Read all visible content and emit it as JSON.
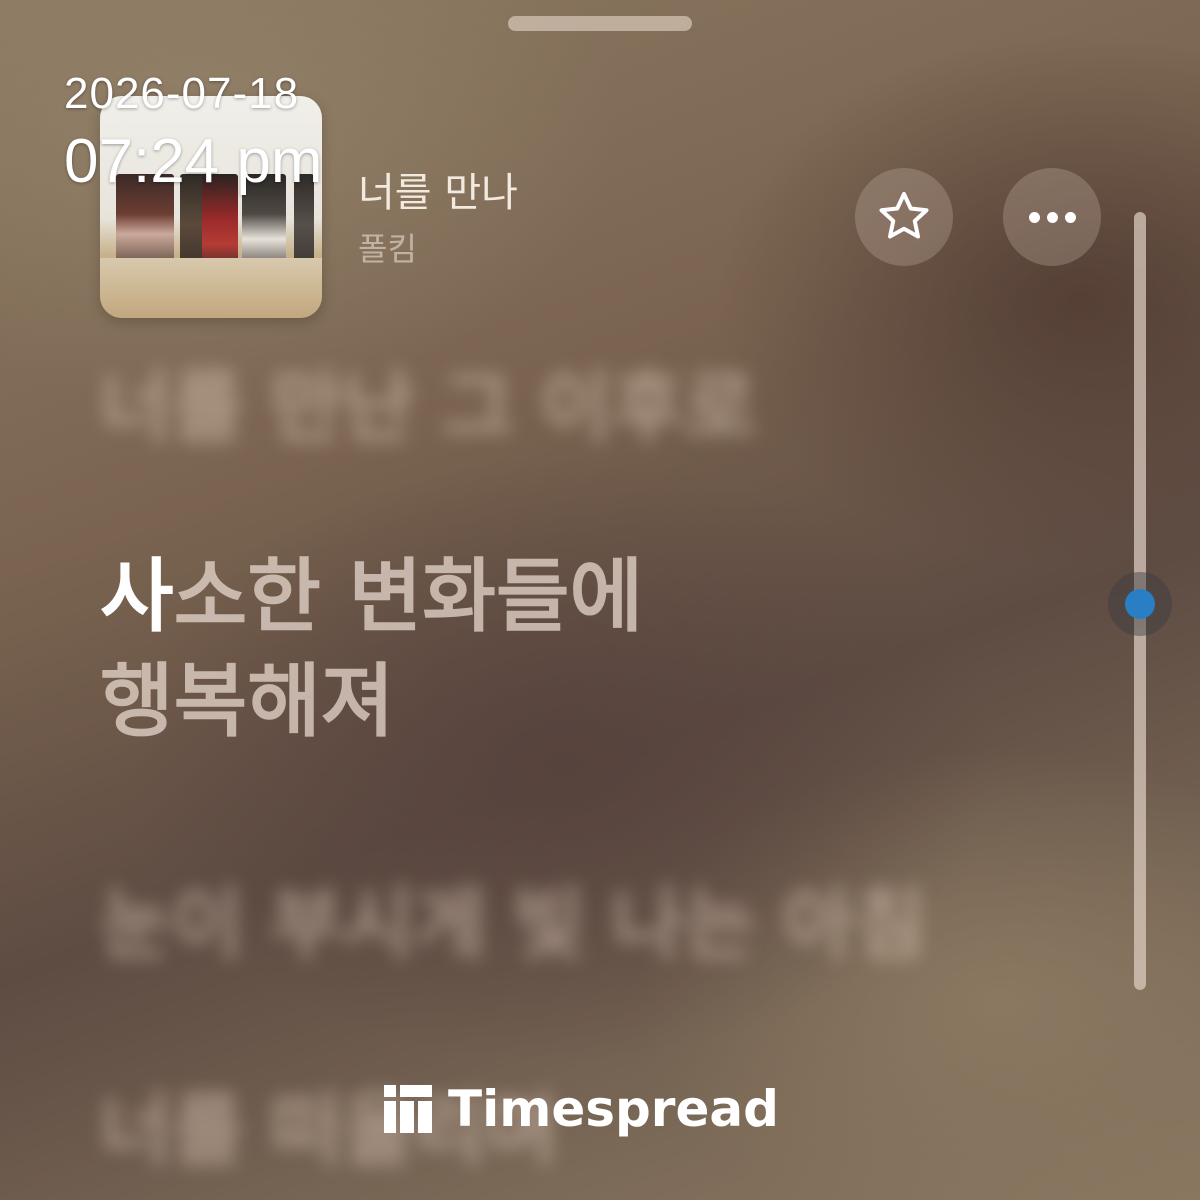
{
  "status": {
    "date": "2026-07-18",
    "time": "07:24 pm"
  },
  "now_playing": {
    "title": "너를 만나",
    "artist": "폴킴"
  },
  "lyrics": {
    "previous": "너를 만난 그 이후로",
    "current_line1_highlight": "사",
    "current_line1_rest": "소한 변화들에",
    "current_line2": "행복해져",
    "next": "눈이 부시게 빛 나는 아침",
    "next2": "너를 떠올리며"
  },
  "icons": {
    "favorite": "star-icon",
    "more": "more-dots-icon",
    "watermark": "timespread-logo"
  },
  "watermark": {
    "text": "Timespread"
  },
  "scroll": {
    "position_fraction": 0.5
  },
  "colors": {
    "accent": "#2a7fc4",
    "text_primary": "#ffffff"
  }
}
